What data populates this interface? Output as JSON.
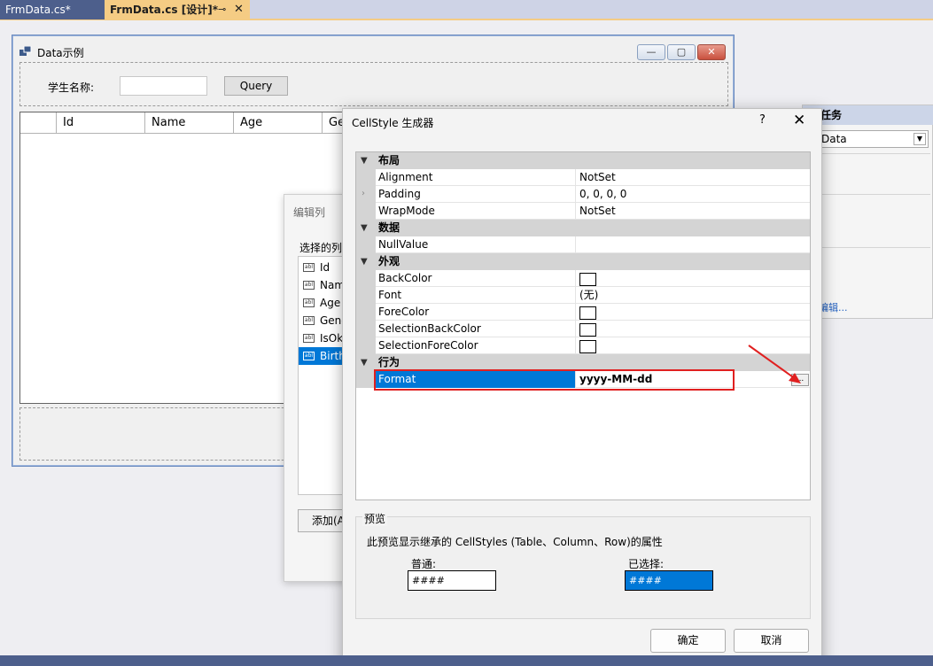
{
  "tabs": [
    {
      "label": "FrmData.cs*"
    },
    {
      "label": "FrmData.cs [设计]*",
      "pin": "⊸",
      "close": "✕"
    }
  ],
  "form": {
    "title": "Data示例",
    "min": "—",
    "max": "▢",
    "close": "✕",
    "search_label": "学生名称:",
    "search_value": "",
    "query_button": "Query",
    "grid_columns": [
      "",
      "Id",
      "Name",
      "Age",
      "Ge"
    ]
  },
  "edit_columns": {
    "title": "编辑列",
    "selected_label": "选择的列:",
    "columns": [
      {
        "label": "Id",
        "icon": "abl"
      },
      {
        "label": "Name",
        "icon": "abl"
      },
      {
        "label": "Age",
        "icon": "abl"
      },
      {
        "label": "Gender",
        "icon": "abl"
      },
      {
        "label": "IsOk",
        "icon": "abl"
      },
      {
        "label": "Birthday",
        "icon": "abl"
      }
    ],
    "add_button": "添加(A)..."
  },
  "props_panel": {
    "header": "任务",
    "combo_value": "Data",
    "link": "编辑..."
  },
  "dialog": {
    "title": "CellStyle 生成器",
    "help": "?",
    "close": "✕",
    "categories": [
      {
        "label": "布局",
        "rows": [
          {
            "name": "Alignment",
            "value": "NotSet"
          },
          {
            "name": "Padding",
            "value": "0, 0, 0, 0"
          },
          {
            "name": "WrapMode",
            "value": "NotSet"
          }
        ]
      },
      {
        "label": "数据",
        "rows": [
          {
            "name": "NullValue",
            "value": ""
          }
        ]
      },
      {
        "label": "外观",
        "rows": [
          {
            "name": "BackColor",
            "value": ""
          },
          {
            "name": "Font",
            "value": "(无)"
          },
          {
            "name": "ForeColor",
            "value": ""
          },
          {
            "name": "SelectionBackColor",
            "value": ""
          },
          {
            "name": "SelectionForeColor",
            "value": ""
          }
        ]
      },
      {
        "label": "行为",
        "rows": [
          {
            "name": "Format",
            "value": "yyyy-MM-dd"
          }
        ]
      }
    ],
    "ellipsis": "...",
    "preview": {
      "label": "预览",
      "description": "此预览显示继承的 CellStyles (Table、Column、Row)的属性",
      "normal_label": "普通:",
      "normal_value": "####",
      "selected_label": "已选择:",
      "selected_value": "####"
    },
    "ok_button": "确定",
    "cancel_button": "取消"
  },
  "colors": {
    "accent": "#0078d7",
    "highlight_box": "#e02020",
    "tab_active": "#f5cc84",
    "tab_inactive": "#4d5f8c"
  }
}
